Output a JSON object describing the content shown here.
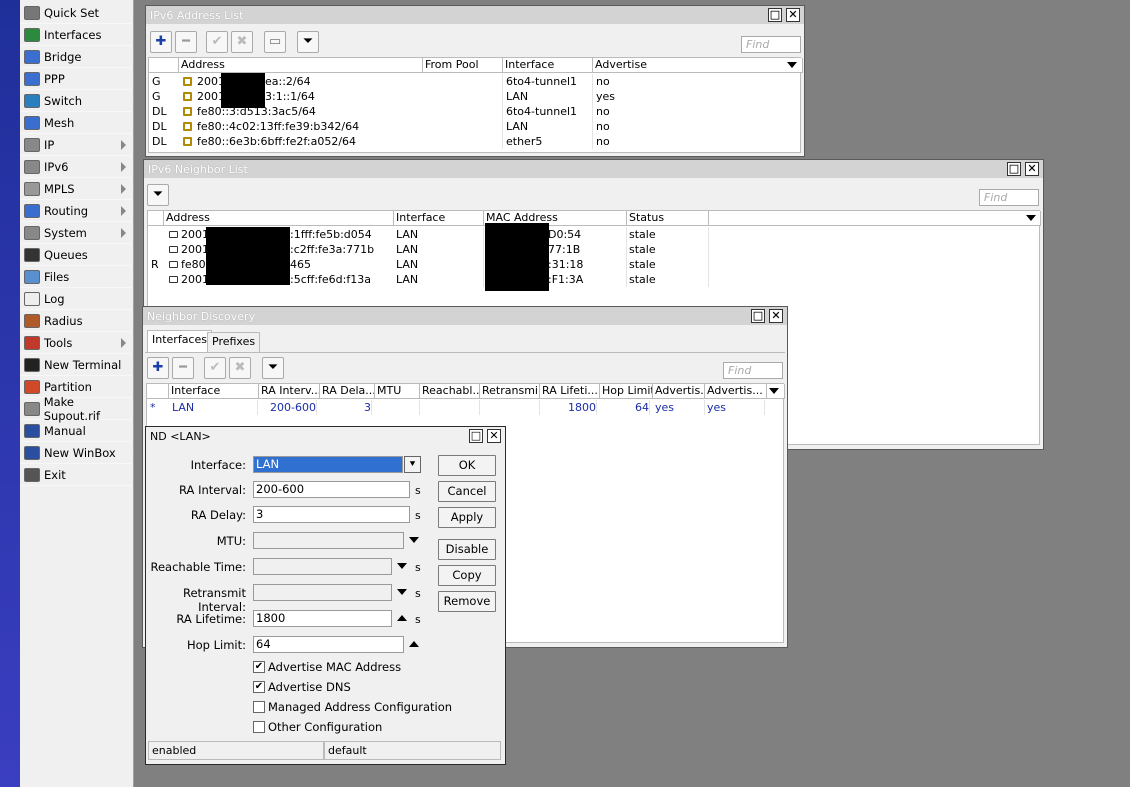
{
  "menu": [
    {
      "label": "Quick Set",
      "icon": "quick-set-icon",
      "color": "#777",
      "arrow": false
    },
    {
      "label": "Interfaces",
      "icon": "interfaces-icon",
      "color": "#2c8a3e",
      "arrow": false
    },
    {
      "label": "Bridge",
      "icon": "bridge-icon",
      "color": "#3a6fd0",
      "arrow": false
    },
    {
      "label": "PPP",
      "icon": "ppp-icon",
      "color": "#3a6fd0",
      "arrow": false
    },
    {
      "label": "Switch",
      "icon": "switch-icon",
      "color": "#2a7fbf",
      "arrow": false
    },
    {
      "label": "Mesh",
      "icon": "mesh-icon",
      "color": "#3a6fd0",
      "arrow": false
    },
    {
      "label": "IP",
      "icon": "ip-icon",
      "color": "#888",
      "arrow": true
    },
    {
      "label": "IPv6",
      "icon": "ipv6-icon",
      "color": "#888",
      "arrow": true
    },
    {
      "label": "MPLS",
      "icon": "mpls-icon",
      "color": "#999",
      "arrow": true
    },
    {
      "label": "Routing",
      "icon": "routing-icon",
      "color": "#3a6fd0",
      "arrow": true
    },
    {
      "label": "System",
      "icon": "system-icon",
      "color": "#888",
      "arrow": true
    },
    {
      "label": "Queues",
      "icon": "queues-icon",
      "color": "#333",
      "arrow": false
    },
    {
      "label": "Files",
      "icon": "files-icon",
      "color": "#5a8fd0",
      "arrow": false
    },
    {
      "label": "Log",
      "icon": "log-icon",
      "color": "#eee",
      "arrow": false
    },
    {
      "label": "Radius",
      "icon": "radius-icon",
      "color": "#b05a2a",
      "arrow": false
    },
    {
      "label": "Tools",
      "icon": "tools-icon",
      "color": "#c0392b",
      "arrow": true
    },
    {
      "label": "New Terminal",
      "icon": "terminal-icon",
      "color": "#222",
      "arrow": false
    },
    {
      "label": "Partition",
      "icon": "partition-icon",
      "color": "#d04a2a",
      "arrow": false
    },
    {
      "label": "Make Supout.rif",
      "icon": "supout-icon",
      "color": "#888",
      "arrow": false
    },
    {
      "label": "Manual",
      "icon": "manual-icon",
      "color": "#2a4fa0",
      "arrow": false
    },
    {
      "label": "New WinBox",
      "icon": "winbox-icon",
      "color": "#2a4fa0",
      "arrow": false
    },
    {
      "label": "Exit",
      "icon": "exit-icon",
      "color": "#555",
      "arrow": false
    }
  ],
  "addr": {
    "title": "IPv6 Address List",
    "find": "Find",
    "cols": [
      "Address",
      "From Pool",
      "Interface",
      "Advertise"
    ],
    "rows": [
      {
        "flag": "G",
        "addr": "2001",
        "tail": "ea::2/64",
        "pool": "",
        "iface": "6to4-tunnel1",
        "adv": "no"
      },
      {
        "flag": "G",
        "addr": "2001",
        "tail": "3:1::1/64",
        "pool": "",
        "iface": "LAN",
        "adv": "yes"
      },
      {
        "flag": "DL",
        "addr": "fe80::3:d513:3ac5/64",
        "tail": "",
        "pool": "",
        "iface": "6to4-tunnel1",
        "adv": "no"
      },
      {
        "flag": "DL",
        "addr": "fe80::4c02:13ff:fe39:b342/64",
        "tail": "",
        "pool": "",
        "iface": "LAN",
        "adv": "no"
      },
      {
        "flag": "DL",
        "addr": "fe80::6e3b:6bff:fe2f:a052/64",
        "tail": "",
        "pool": "",
        "iface": "ether5",
        "adv": "no"
      }
    ]
  },
  "neigh": {
    "title": "IPv6 Neighbor List",
    "find": "Find",
    "cols": [
      "Address",
      "Interface",
      "MAC Address",
      "Status"
    ],
    "rows": [
      {
        "flag": "",
        "addr": "2001",
        "tail": ":1fff:fe5b:d054",
        "iface": "LAN",
        "mac": "D0:54",
        "status": "stale"
      },
      {
        "flag": "",
        "addr": "2001",
        "tail": ":c2ff:fe3a:771b",
        "iface": "LAN",
        "mac": "77:1B",
        "status": "stale"
      },
      {
        "flag": "R",
        "addr": "fe80:",
        "tail": "465",
        "iface": "LAN",
        "mac": ":31:18",
        "status": "stale"
      },
      {
        "flag": "",
        "addr": "2001",
        "tail": ":5cff:fe6d:f13a",
        "iface": "LAN",
        "mac": ":F1:3A",
        "status": "stale"
      }
    ]
  },
  "nd": {
    "title": "Neighbor Discovery",
    "tabs": [
      "Interfaces",
      "Prefixes"
    ],
    "find": "Find",
    "cols": [
      "Interface",
      "RA Interv...",
      "RA Dela...",
      "MTU",
      "Reachabl...",
      "Retransmi...",
      "RA Lifeti...",
      "Hop Limit",
      "Advertis...",
      "Advertis..."
    ],
    "row": {
      "flag": "*",
      "iface": "LAN",
      "interval": "200-600",
      "delay": "3",
      "mtu": "",
      "reach": "",
      "retr": "",
      "lifetime": "1800",
      "hop": "64",
      "advmac": "yes",
      "advdns": "yes"
    }
  },
  "dlg": {
    "title": "ND <LAN>",
    "labels": {
      "interface": "Interface:",
      "interval": "RA Interval:",
      "delay": "RA Delay:",
      "mtu": "MTU:",
      "reach": "Reachable Time:",
      "retr": "Retransmit Interval:",
      "lifetime": "RA Lifetime:",
      "hop": "Hop Limit:"
    },
    "values": {
      "interface": "LAN",
      "interval": "200-600",
      "delay": "3",
      "mtu": "",
      "reach": "",
      "retr": "",
      "lifetime": "1800",
      "hop": "64"
    },
    "unit": "s",
    "buttons": [
      "OK",
      "Cancel",
      "Apply",
      "Disable",
      "Copy",
      "Remove"
    ],
    "checks": [
      {
        "label": "Advertise MAC Address",
        "checked": true
      },
      {
        "label": "Advertise DNS",
        "checked": true
      },
      {
        "label": "Managed Address Configuration",
        "checked": false
      },
      {
        "label": "Other Configuration",
        "checked": false
      }
    ],
    "status_left": "enabled",
    "status_right": "default"
  }
}
